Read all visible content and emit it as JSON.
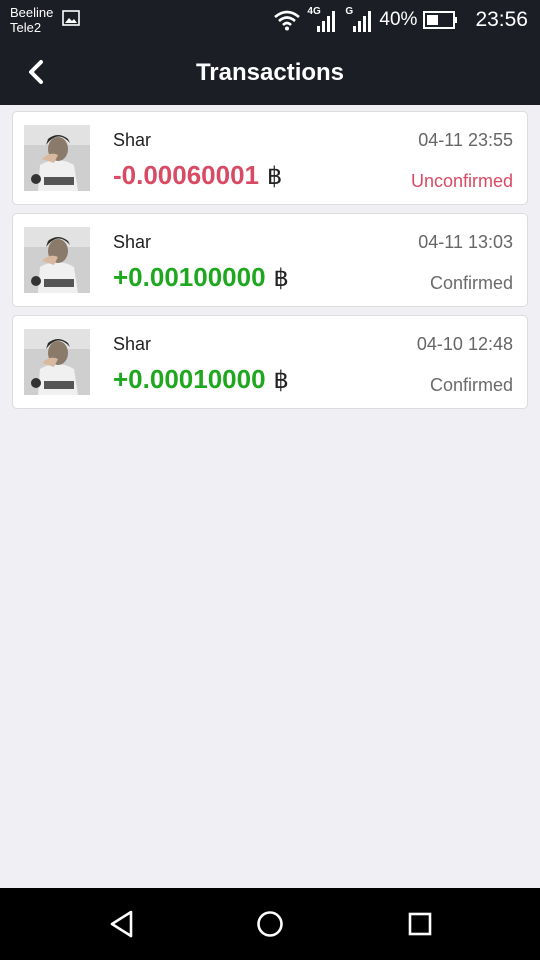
{
  "status_bar": {
    "carrier1": "Beeline",
    "carrier2": "Tele2",
    "net1": "4G",
    "net2": "G",
    "battery": "40%",
    "time": "23:56"
  },
  "header": {
    "title": "Transactions"
  },
  "transactions": [
    {
      "name": "Shar",
      "amount": "-0.00060001",
      "currency": "฿",
      "date": "04-11 23:55",
      "status": "Unconfirmed",
      "amount_color": "#d94a64",
      "status_color": "#d94a64"
    },
    {
      "name": "Shar",
      "amount": "+0.00100000",
      "currency": "฿",
      "date": "04-11 13:03",
      "status": "Confirmed",
      "amount_color": "#1fa81f",
      "status_color": "#6b6b6b"
    },
    {
      "name": "Shar",
      "amount": "+0.00010000",
      "currency": "฿",
      "date": "04-10 12:48",
      "status": "Confirmed",
      "amount_color": "#1fa81f",
      "status_color": "#6b6b6b"
    }
  ]
}
